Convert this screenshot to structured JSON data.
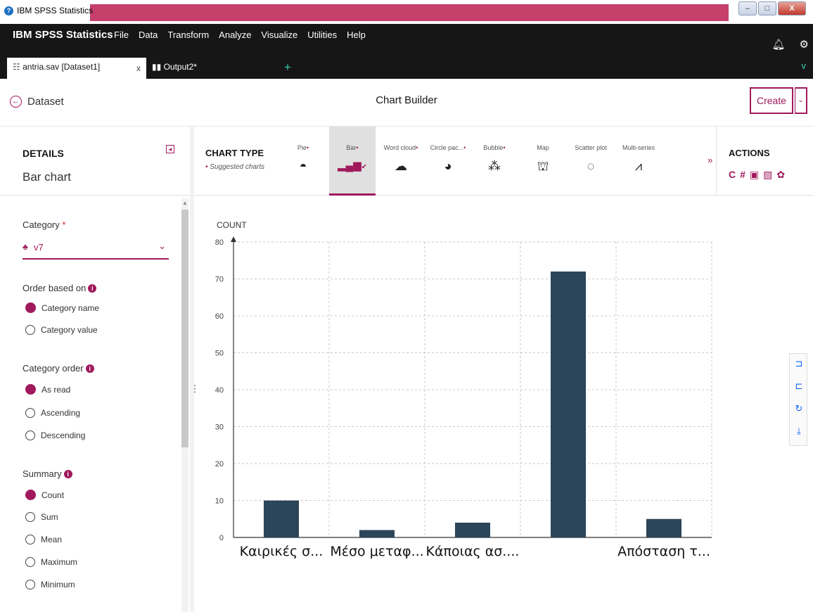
{
  "window": {
    "title": "IBM SPSS Statistics",
    "minimize": "–",
    "maximize": "□",
    "close": "X"
  },
  "menubar": {
    "brand_bold": "IBM SPSS Statistics",
    "items": [
      "File",
      "Data",
      "Transform",
      "Analyze",
      "Visualize",
      "Utilities",
      "Help"
    ]
  },
  "tabs": {
    "active_label": "antria.sav [Dataset1]",
    "active_close": "x",
    "second_label": "Output2*",
    "add": "+",
    "expand": "v"
  },
  "header": {
    "back_label": "Dataset",
    "title": "Chart Builder",
    "create_label": "Create"
  },
  "details": {
    "label": "DETAILS",
    "value": "Bar chart"
  },
  "chart_type": {
    "label": "CHART TYPE",
    "suggested": "Suggested charts",
    "types": [
      {
        "name": "Pie",
        "suggested": true,
        "icon": "pie-chart-icon",
        "active": false
      },
      {
        "name": "Bar",
        "suggested": true,
        "icon": "bar-chart-icon",
        "active": true
      },
      {
        "name": "Word cloud",
        "suggested": true,
        "icon": "word-cloud-icon",
        "active": false
      },
      {
        "name": "Circle pac...",
        "suggested": true,
        "icon": "circle-packing-icon",
        "active": false
      },
      {
        "name": "Bubble",
        "suggested": true,
        "icon": "bubble-icon",
        "active": false
      },
      {
        "name": "Map",
        "suggested": false,
        "icon": "map-icon",
        "active": false
      },
      {
        "name": "Scatter plot",
        "suggested": false,
        "icon": "scatter-plot-icon",
        "active": false
      },
      {
        "name": "Multi-series",
        "suggested": false,
        "icon": "multi-series-icon",
        "active": false
      }
    ]
  },
  "actions": {
    "label": "ACTIONS"
  },
  "left_panel": {
    "category_label": "Category",
    "category_required": "*",
    "category_value": "v7",
    "order_based_on": {
      "title": "Order based on",
      "options": [
        "Category name",
        "Category value"
      ],
      "selected": 0
    },
    "category_order": {
      "title": "Category order",
      "options": [
        "As read",
        "Ascending",
        "Descending"
      ],
      "selected": 0
    },
    "summary": {
      "title": "Summary",
      "options": [
        "Count",
        "Sum",
        "Mean",
        "Maximum",
        "Minimum"
      ],
      "selected": 0
    }
  },
  "colors": {
    "accent": "#a0195c",
    "bar": "#2b4559",
    "menubar": "#161616",
    "titlebar_strip": "#c6406b",
    "tools": "#0f62fe"
  },
  "chart_data": {
    "type": "bar",
    "ylabel": "COUNT",
    "xlabel": "",
    "ylim": [
      0,
      80
    ],
    "yticks": [
      0,
      10,
      20,
      30,
      40,
      50,
      60,
      70,
      80
    ],
    "categories": [
      "Καιρικές σ...",
      "Μέσο μεταφ...",
      "Κάποιας ασ....",
      "",
      "Απόσταση τ..."
    ],
    "values": [
      10,
      2,
      4,
      72,
      5
    ],
    "grid": true
  }
}
